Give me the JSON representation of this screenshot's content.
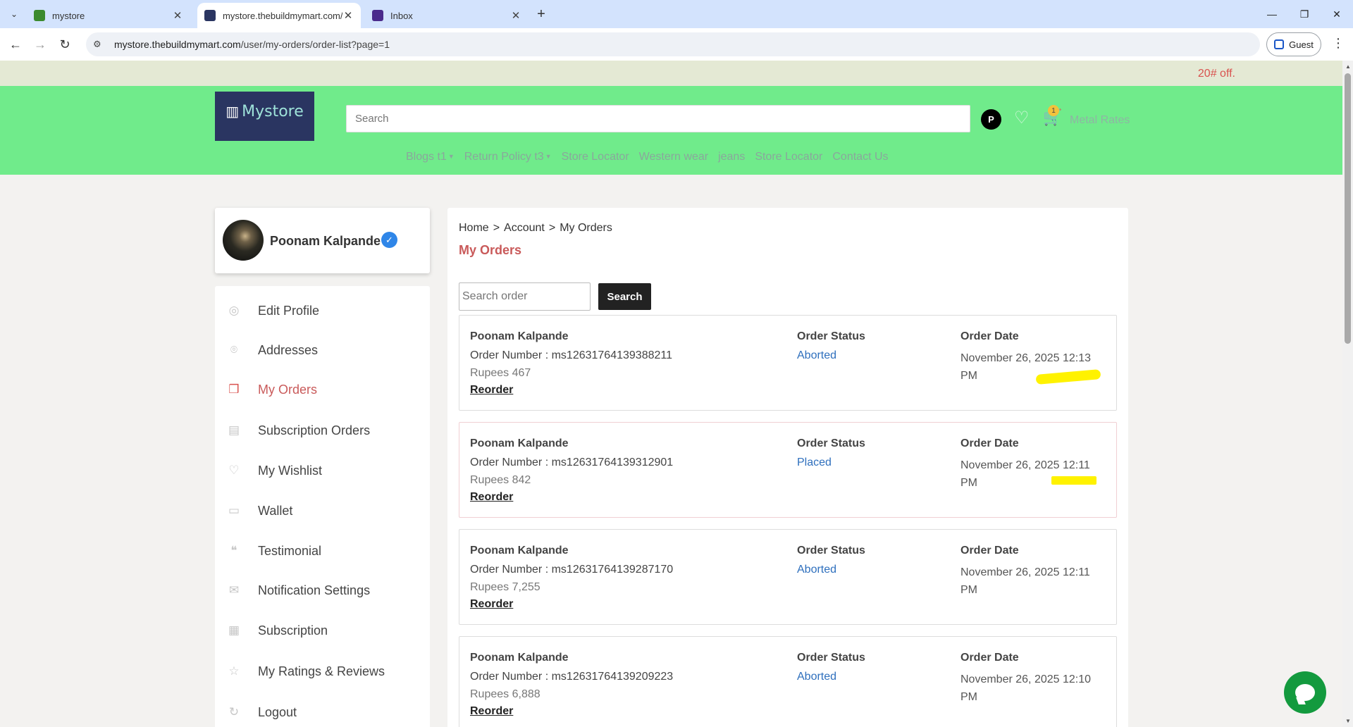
{
  "browser": {
    "tabs": [
      {
        "title": "mystore",
        "favicon_color": "#3b8a2e"
      },
      {
        "title": "mystore.thebuildmymart.com/u",
        "favicon_color": "#2a3561"
      },
      {
        "title": "Inbox",
        "favicon_color": "#4a2a8c"
      }
    ],
    "url_host": "mystore.thebuildmymart.com",
    "url_path": "/user/my-orders/order-list?page=1",
    "profile_label": "Guest"
  },
  "site": {
    "promo": "20# off.",
    "logo_text": "Mystore",
    "search_placeholder": "Search",
    "avatar_initial": "P",
    "cart_count": "1",
    "metal_rates": "Metal Rates",
    "nav": [
      {
        "label": "Blogs t1",
        "dropdown": true
      },
      {
        "label": "Return Policy t3",
        "dropdown": true
      },
      {
        "label": "Store Locator",
        "dropdown": false
      },
      {
        "label": "Western wear",
        "dropdown": false
      },
      {
        "label": "jeans",
        "dropdown": false
      },
      {
        "label": "Store Locator",
        "dropdown": false
      },
      {
        "label": "Contact Us",
        "dropdown": false
      }
    ],
    "colors": {
      "header": "#70eb8b",
      "accent": "#c95a5a",
      "status_link": "#2e6fbd"
    }
  },
  "profile": {
    "name": "Poonam Kalpande"
  },
  "menu": [
    {
      "label": "Edit Profile",
      "icon": "user-icon"
    },
    {
      "label": "Addresses",
      "icon": "location-pin-icon"
    },
    {
      "label": "My Orders",
      "icon": "orders-icon",
      "active": true
    },
    {
      "label": "Subscription Orders",
      "icon": "calendar-icon"
    },
    {
      "label": "My Wishlist",
      "icon": "heart-icon"
    },
    {
      "label": "Wallet",
      "icon": "wallet-icon"
    },
    {
      "label": "Testimonial",
      "icon": "quote-icon"
    },
    {
      "label": "Notification Settings",
      "icon": "mail-icon"
    },
    {
      "label": "Subscription",
      "icon": "subscription-icon"
    },
    {
      "label": "My Ratings & Reviews",
      "icon": "star-icon"
    },
    {
      "label": "Logout",
      "icon": "logout-icon"
    }
  ],
  "main": {
    "breadcrumb": [
      "Home",
      "Account",
      "My Orders"
    ],
    "breadcrumb_sep": ">",
    "heading": "My Orders",
    "search_placeholder": "Search order",
    "search_button": "Search",
    "status_header": "Order Status",
    "date_header": "Order Date",
    "reorder_label": "Reorder",
    "orders": [
      {
        "customer": "Poonam Kalpande",
        "number": "Order Number : ms12631764139388211",
        "amount": "Rupees 467",
        "status": "Aborted",
        "date": "November 26, 2025 12:13 PM"
      },
      {
        "customer": "Poonam Kalpande",
        "number": "Order Number : ms12631764139312901",
        "amount": "Rupees 842",
        "status": "Placed",
        "date": "November 26, 2025 12:11 PM"
      },
      {
        "customer": "Poonam Kalpande",
        "number": "Order Number : ms12631764139287170",
        "amount": "Rupees 7,255",
        "status": "Aborted",
        "date": "November 26, 2025 12:11 PM"
      },
      {
        "customer": "Poonam Kalpande",
        "number": "Order Number : ms12631764139209223",
        "amount": "Rupees 6,888",
        "status": "Aborted",
        "date": "November 26, 2025 12:10 PM"
      }
    ]
  }
}
